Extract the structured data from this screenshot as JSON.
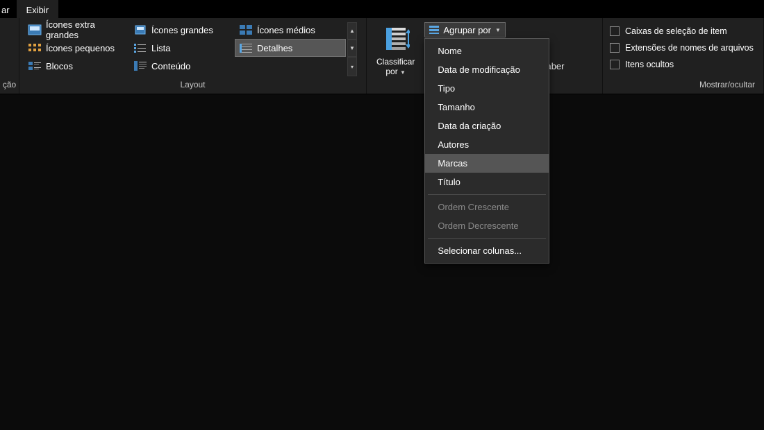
{
  "tabs": {
    "partial": "ar",
    "active": "Exibir"
  },
  "panes": {
    "label_fragment": "ção"
  },
  "layout": {
    "group_label": "Layout",
    "items": [
      {
        "id": "xl",
        "label": "Ícones extra grandes",
        "active": false
      },
      {
        "id": "lg",
        "label": "Ícones grandes",
        "active": false
      },
      {
        "id": "md",
        "label": "Ícones médios",
        "active": false
      },
      {
        "id": "sm",
        "label": "Ícones pequenos",
        "active": false
      },
      {
        "id": "list",
        "label": "Lista",
        "active": false
      },
      {
        "id": "det",
        "label": "Detalhes",
        "active": true
      },
      {
        "id": "blk",
        "label": "Blocos",
        "active": false
      },
      {
        "id": "cnt",
        "label": "Conteúdo",
        "active": false
      }
    ]
  },
  "sort": {
    "label_line1": "Classificar",
    "label_line2": "por"
  },
  "groupby": {
    "button_label": "Agrupar por",
    "menu": [
      {
        "label": "Nome",
        "type": "item"
      },
      {
        "label": "Data de modificação",
        "type": "item"
      },
      {
        "label": "Tipo",
        "type": "item"
      },
      {
        "label": "Tamanho",
        "type": "item"
      },
      {
        "label": "Data da criação",
        "type": "item"
      },
      {
        "label": "Autores",
        "type": "item"
      },
      {
        "label": "Marcas",
        "type": "item",
        "hover": true
      },
      {
        "label": "Título",
        "type": "item"
      },
      {
        "type": "sep"
      },
      {
        "label": "Ordem Crescente",
        "type": "item",
        "disabled": true
      },
      {
        "label": "Ordem Decrescente",
        "type": "item",
        "disabled": true
      },
      {
        "type": "sep"
      },
      {
        "label": "Selecionar colunas...",
        "type": "item"
      }
    ]
  },
  "size_columns": {
    "visible_fragment": "as para caber"
  },
  "showhide": {
    "group_label": "Mostrar/ocultar",
    "items": [
      {
        "label": "Caixas de seleção de item"
      },
      {
        "label": "Extensões de nomes de arquivos"
      },
      {
        "label": "Itens ocultos"
      }
    ]
  }
}
